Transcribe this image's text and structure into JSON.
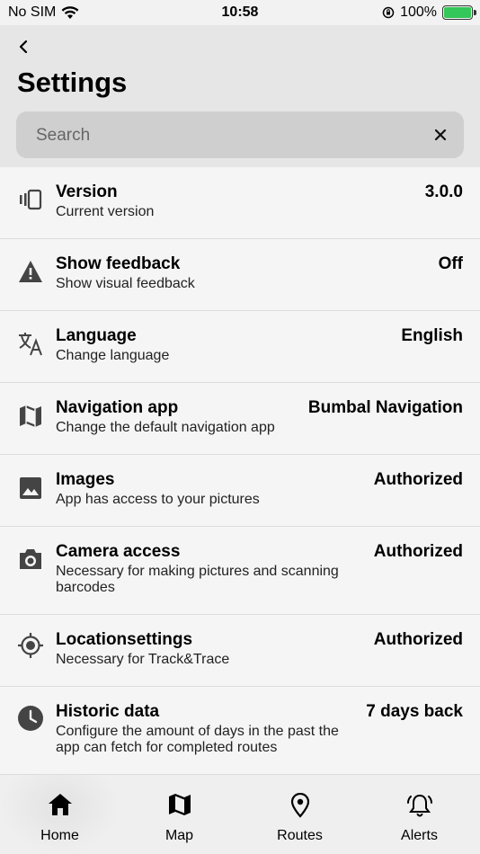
{
  "status": {
    "carrier": "No SIM",
    "time": "10:58",
    "battery": "100%"
  },
  "header": {
    "title": "Settings"
  },
  "search": {
    "placeholder": "Search"
  },
  "settings": [
    {
      "icon": "version-icon",
      "title": "Version",
      "subtitle": "Current version",
      "value": "3.0.0"
    },
    {
      "icon": "warning-icon",
      "title": "Show feedback",
      "subtitle": "Show visual feedback",
      "value": "Off"
    },
    {
      "icon": "translate-icon",
      "title": "Language",
      "subtitle": "Change language",
      "value": "English"
    },
    {
      "icon": "map-icon",
      "title": "Navigation app",
      "subtitle": "Change the default navigation app",
      "value": "Bumbal Navigation"
    },
    {
      "icon": "image-icon",
      "title": "Images",
      "subtitle": "App has access to your pictures",
      "value": "Authorized"
    },
    {
      "icon": "camera-icon",
      "title": "Camera access",
      "subtitle": "Necessary for making pictures and scanning barcodes",
      "value": "Authorized"
    },
    {
      "icon": "location-target-icon",
      "title": "Locationsettings",
      "subtitle": "Necessary for Track&Trace",
      "value": "Authorized"
    },
    {
      "icon": "clock-icon",
      "title": "Historic data",
      "subtitle": "Configure the amount of days in the past the app can fetch for completed routes",
      "value": "7 days back"
    }
  ],
  "tabs": [
    {
      "icon": "home-icon",
      "label": "Home"
    },
    {
      "icon": "map-icon",
      "label": "Map"
    },
    {
      "icon": "location-pin-icon",
      "label": "Routes"
    },
    {
      "icon": "bell-icon",
      "label": "Alerts"
    }
  ]
}
